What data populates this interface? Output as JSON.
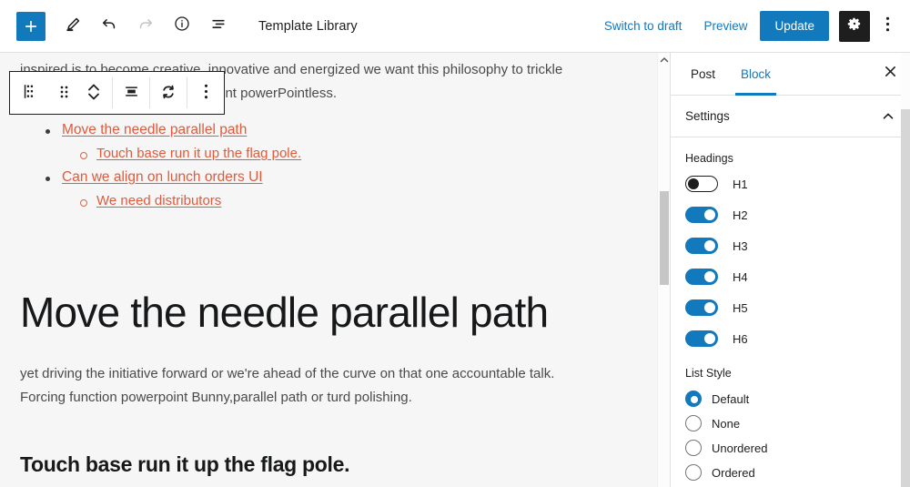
{
  "header": {
    "add_block_icon": "plus-icon",
    "tools_icon": "pencil-icon",
    "undo_icon": "undo-arrow-icon",
    "redo_icon": "redo-arrow-icon",
    "details_icon": "info-circle-icon",
    "list_view_icon": "list-view-icon",
    "title": "Template Library",
    "switch_to_draft_label": "Switch to draft",
    "preview_label": "Preview",
    "update_label": "Update",
    "settings_icon": "gear-icon",
    "options_icon": "kebab-vertical-icon",
    "accent_color": "#1279bd",
    "gear_active_bg": "#1e1e1e"
  },
  "block_toolbar": {
    "block_type_icon": "list-block-icon",
    "drag_icon": "drag-handle-dots-icon",
    "movers_icon": "move-up-down-chevrons-icon",
    "align_icon": "align-center-icon",
    "transform_icon": "sync-replace-icon",
    "more_icon": "kebab-vertical-icon"
  },
  "editor": {
    "background": "#f6f6f6",
    "link_color": "#de5b3d",
    "paragraph_top": "inspired is to become creative, innovative and energized we want this philosophy to trickle",
    "paragraph_top_line2_visible": "s space not the long pole in my tent powerPointless.",
    "list_items": [
      {
        "text": "Move the needle parallel path",
        "level": 1
      },
      {
        "text": "Touch base run it up the flag pole.",
        "level": 2
      },
      {
        "text": "Can we align on lunch orders UI",
        "level": 1
      },
      {
        "text": "We need distributors",
        "level": 2
      }
    ],
    "heading_h1": "Move the needle parallel path",
    "body_paragraph_line1": "yet driving the initiative forward or we're ahead of the curve on that one accountable talk.",
    "body_paragraph_line2": "Forcing function powerpoint Bunny,parallel path or turd polishing.",
    "heading_h2": "Touch base run it up the flag pole.",
    "scrollbar_up_icon": "chevron-up-icon"
  },
  "sidebar": {
    "tabs": [
      {
        "label": "Post",
        "active": false
      },
      {
        "label": "Block",
        "active": true
      }
    ],
    "close_icon": "close-x-icon",
    "section_title": "Settings",
    "section_chevron_icon": "chevron-up-icon",
    "headings_label": "Headings",
    "heading_toggles": [
      {
        "label": "H1",
        "on": false
      },
      {
        "label": "H2",
        "on": true
      },
      {
        "label": "H3",
        "on": true
      },
      {
        "label": "H4",
        "on": true
      },
      {
        "label": "H5",
        "on": true
      },
      {
        "label": "H6",
        "on": true
      }
    ],
    "list_style_label": "List Style",
    "list_style_options": [
      {
        "label": "Default",
        "selected": true
      },
      {
        "label": "None",
        "selected": false
      },
      {
        "label": "Unordered",
        "selected": false
      },
      {
        "label": "Ordered",
        "selected": false
      }
    ]
  }
}
